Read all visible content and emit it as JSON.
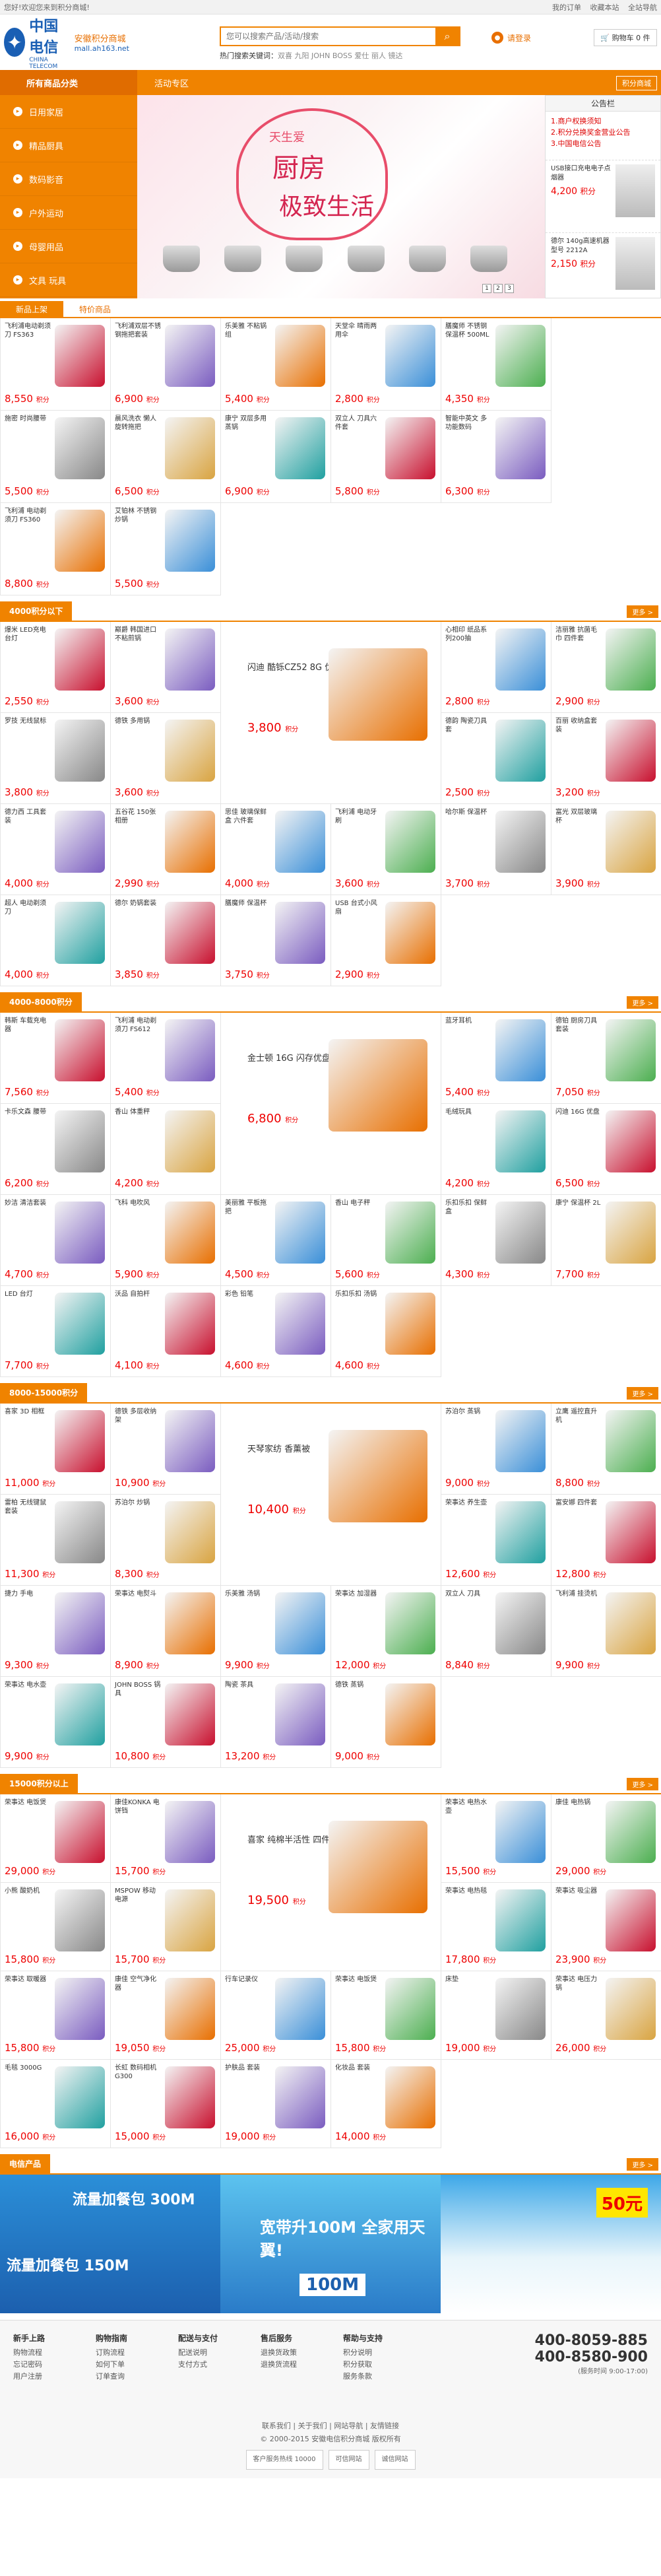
{
  "topbar": {
    "left": "您好!欢迎您来到积分商城!",
    "links": [
      "我的订单",
      "收藏本站",
      "全站导航"
    ]
  },
  "header": {
    "logo_cn": "中国电信",
    "logo_en": "CHINA TELECOM",
    "site_name": "安徽积分商城",
    "site_url": "mall.ah163.net",
    "search_placeholder": "您可以搜索产品/活动/搜索",
    "hot_label": "热门搜索关键词：",
    "hot_words": "双喜 九阳 JOHN BOSS 爱仕 丽人 镜达",
    "login": "请登录",
    "cart": "购物车 0 件"
  },
  "nav": {
    "all": "所有商品分类",
    "items": [
      "活动专区"
    ],
    "right": "积分商城"
  },
  "categories": [
    "日用家居",
    "精品厨具",
    "数码影音",
    "户外运动",
    "母婴用品",
    "文具 玩具"
  ],
  "banner": {
    "t1": "天生爱",
    "t2": "厨房",
    "t3": "极致生活",
    "pages": [
      "1",
      "2",
      "3"
    ]
  },
  "notice": {
    "title": "公告栏",
    "items": [
      "1.商户权换须知",
      "2.积分兑换奖金营业公告",
      "3.中国电信公告"
    ],
    "p1_name": "USB接口充电电子点烟器",
    "p1_price": "4,200",
    "p2_name": "德尔 140g高速机器 型号 2212A",
    "p2_price": "2,150"
  },
  "tabs": [
    "新品上架",
    "特价商品"
  ],
  "unit": "积分",
  "sections": [
    "4000积分以下",
    "4000-8000积分",
    "8000-15000积分",
    "15000积分以上",
    "电信产品"
  ],
  "more": "更多 >",
  "grid_new": [
    {
      "n": "飞利浦电动剃须刀 FS363",
      "p": "8,550"
    },
    {
      "n": "飞利浦双层不锈钢拖把套装",
      "p": "6,900"
    },
    {
      "n": "乐美雅 不粘锅组",
      "p": "5,400"
    },
    {
      "n": "天堂伞 晴雨两用伞",
      "p": "2,800"
    },
    {
      "n": "膳魔师 不锈钢保温杯 500ML",
      "p": "4,350"
    },
    {
      "n": "施密 时尚腰带",
      "p": "5,500"
    },
    {
      "n": "晨风洗衣 懒人旋转拖把",
      "p": "6,500"
    },
    {
      "n": "康宁 双层多用蒸锅",
      "p": "6,900"
    },
    {
      "n": "双立人 刀具六件套",
      "p": "5,800"
    },
    {
      "n": "智能中英文 多功能数码",
      "p": "6,300"
    },
    {
      "n": "飞利浦 电动剃须刀 FS360",
      "p": "8,800"
    },
    {
      "n": "艾铂林 不锈钢 炒锅",
      "p": "5,500"
    }
  ],
  "grid_a": [
    {
      "n": "爆米 LED充电台灯",
      "p": "2,550"
    },
    {
      "n": "巅爵 韩国进口 不粘煎锅",
      "p": "3,600"
    },
    {
      "n": "闪迪 酷铄CZ52 8G 优盘",
      "p": "3,800"
    },
    {
      "n": "心相印 纸品系列200抽",
      "p": "2,800"
    },
    {
      "n": "洁丽雅 抗菌毛巾 四件套",
      "p": "2,900"
    },
    {
      "n": "罗技 无线鼠标",
      "p": "3,800"
    },
    {
      "n": "德铁 多用锅",
      "p": "3,600"
    },
    {
      "n": "德韵 陶瓷刀具套",
      "p": "2,500"
    },
    {
      "n": "百丽 收纳盒套装",
      "p": "3,200"
    },
    {
      "n": "德力西 工具套装",
      "p": "4,000"
    },
    {
      "n": "五谷花 150张 相册",
      "p": "2,990"
    },
    {
      "n": "思佳 玻璃保鲜盒 六件套",
      "p": "4,000"
    },
    {
      "n": "飞利浦 电动牙刷",
      "p": "3,600"
    },
    {
      "n": "哈尔斯 保温杯",
      "p": "3,700"
    },
    {
      "n": "富光 双层玻璃杯",
      "p": "3,900"
    },
    {
      "n": "超人 电动剃须刀",
      "p": "4,000"
    },
    {
      "n": "德尔 奶锅套装",
      "p": "3,850"
    },
    {
      "n": "膳魔师 保温杯",
      "p": "3,750"
    },
    {
      "n": "USB 台式小风扇",
      "p": "2,900"
    }
  ],
  "grid_b": [
    {
      "n": "韩斯 车载充电器",
      "p": "7,560"
    },
    {
      "n": "飞利浦 电动剃须刀 FS612",
      "p": "5,400"
    },
    {
      "n": "金士顿 16G 闪存优盘",
      "p": "6,800"
    },
    {
      "n": "蓝牙耳机",
      "p": "5,400"
    },
    {
      "n": "德铂 厨房刀具套装",
      "p": "7,050"
    },
    {
      "n": "卡乐文森 腰带",
      "p": "6,200"
    },
    {
      "n": "香山 体重秤",
      "p": "4,200"
    },
    {
      "n": "毛绒玩具",
      "p": "4,200"
    },
    {
      "n": "闪迪 16G 优盘",
      "p": "6,500"
    },
    {
      "n": "妙洁 清洁套装",
      "p": "4,700"
    },
    {
      "n": "飞科 电吹风",
      "p": "5,900"
    },
    {
      "n": "美丽雅 平板拖把",
      "p": "4,500"
    },
    {
      "n": "香山 电子秤",
      "p": "5,600"
    },
    {
      "n": "乐扣乐扣 保鲜盒",
      "p": "4,300"
    },
    {
      "n": "康宁 保温杯 2L",
      "p": "7,700"
    },
    {
      "n": "LED 台灯",
      "p": "7,700"
    },
    {
      "n": "沃品 自拍杆",
      "p": "4,100"
    },
    {
      "n": "彩色 铅笔",
      "p": "4,600"
    },
    {
      "n": "乐扣乐扣 汤锅",
      "p": "4,600"
    }
  ],
  "grid_c": [
    {
      "n": "喜家 3D 相框",
      "p": "11,000"
    },
    {
      "n": "德铁 多层收纳架",
      "p": "10,900"
    },
    {
      "n": "天琴家纺 香薰被",
      "p": "10,400"
    },
    {
      "n": "苏泊尔 蒸锅",
      "p": "9,000"
    },
    {
      "n": "立鹰 遥控直升机",
      "p": "8,800"
    },
    {
      "n": "雷柏 无线键鼠套装",
      "p": "11,300"
    },
    {
      "n": "苏泊尔 炒锅",
      "p": "8,300"
    },
    {
      "n": "荣事达 养生壶",
      "p": "12,600"
    },
    {
      "n": "富安娜 四件套",
      "p": "12,800"
    },
    {
      "n": "捷力 手电",
      "p": "9,300"
    },
    {
      "n": "荣事达 电熨斗",
      "p": "8,900"
    },
    {
      "n": "乐美雅 汤锅",
      "p": "9,900"
    },
    {
      "n": "荣事达 加湿器",
      "p": "12,000"
    },
    {
      "n": "双立人 刀具",
      "p": "8,840"
    },
    {
      "n": "飞利浦 挂烫机",
      "p": "9,900"
    },
    {
      "n": "荣事达 电水壶",
      "p": "9,900"
    },
    {
      "n": "JOHN BOSS 锅具",
      "p": "10,800"
    },
    {
      "n": "陶瓷 茶具",
      "p": "13,200"
    },
    {
      "n": "德铁 蒸锅",
      "p": "9,000"
    }
  ],
  "grid_d": [
    {
      "n": "荣事达 电饭煲",
      "p": "29,000"
    },
    {
      "n": "康佳KONKA 电饼铛",
      "p": "15,700"
    },
    {
      "n": "喜家 纯棉半活性 四件套",
      "p": "19,500"
    },
    {
      "n": "荣事达 电热水壶",
      "p": "15,500"
    },
    {
      "n": "康佳 电热锅",
      "p": "29,000"
    },
    {
      "n": "小熊 酸奶机",
      "p": "15,800"
    },
    {
      "n": "MSPOW 移动电源",
      "p": "15,700"
    },
    {
      "n": "荣事达 电热毯",
      "p": "17,800"
    },
    {
      "n": "荣事达 吸尘器",
      "p": "23,900"
    },
    {
      "n": "荣事达 取暖器",
      "p": "15,800"
    },
    {
      "n": "康佳 空气净化器",
      "p": "19,050"
    },
    {
      "n": "行车记录仪",
      "p": "25,000"
    },
    {
      "n": "荣事达 电饭煲",
      "p": "15,800"
    },
    {
      "n": "床垫",
      "p": "19,000"
    },
    {
      "n": "荣事达 电压力锅",
      "p": "26,000"
    },
    {
      "n": "毛毯 3000G",
      "p": "16,000"
    },
    {
      "n": "长虹 数码相机 G300",
      "p": "15,000"
    },
    {
      "n": "护肤品 套装",
      "p": "19,000"
    },
    {
      "n": "化妆品 套装",
      "p": "14,000"
    }
  ],
  "ads": {
    "a1": "流量加餐包 300M",
    "a2": "流量加餐包 150M",
    "a3": "宽带升100M 全家用天翼!",
    "a4": "100M",
    "a5": "50元"
  },
  "footer": {
    "cols": [
      {
        "t": "新手上路",
        "i": [
          "购物流程",
          "忘记密码",
          "用户注册"
        ]
      },
      {
        "t": "购物指南",
        "i": [
          "订购流程",
          "如何下单",
          "订单查询"
        ]
      },
      {
        "t": "配送与支付",
        "i": [
          "配送说明",
          "支付方式"
        ]
      },
      {
        "t": "售后服务",
        "i": [
          "退换货政策",
          "退换货流程"
        ]
      },
      {
        "t": "帮助与支持",
        "i": [
          "积分说明",
          "积分获取",
          "服务条款"
        ]
      }
    ],
    "hotline": [
      "400-8059-885",
      "400-8580-900"
    ],
    "hours": "(服务时间 9:00-17:00)",
    "links": "联系我们 | 关于我们 | 网站导航 | 友情链接",
    "copy": "© 2000-2015 安徽电信积分商城 版权所有",
    "badges": [
      "客户服务热线 10000",
      "可信网站",
      "诚信网站"
    ]
  }
}
